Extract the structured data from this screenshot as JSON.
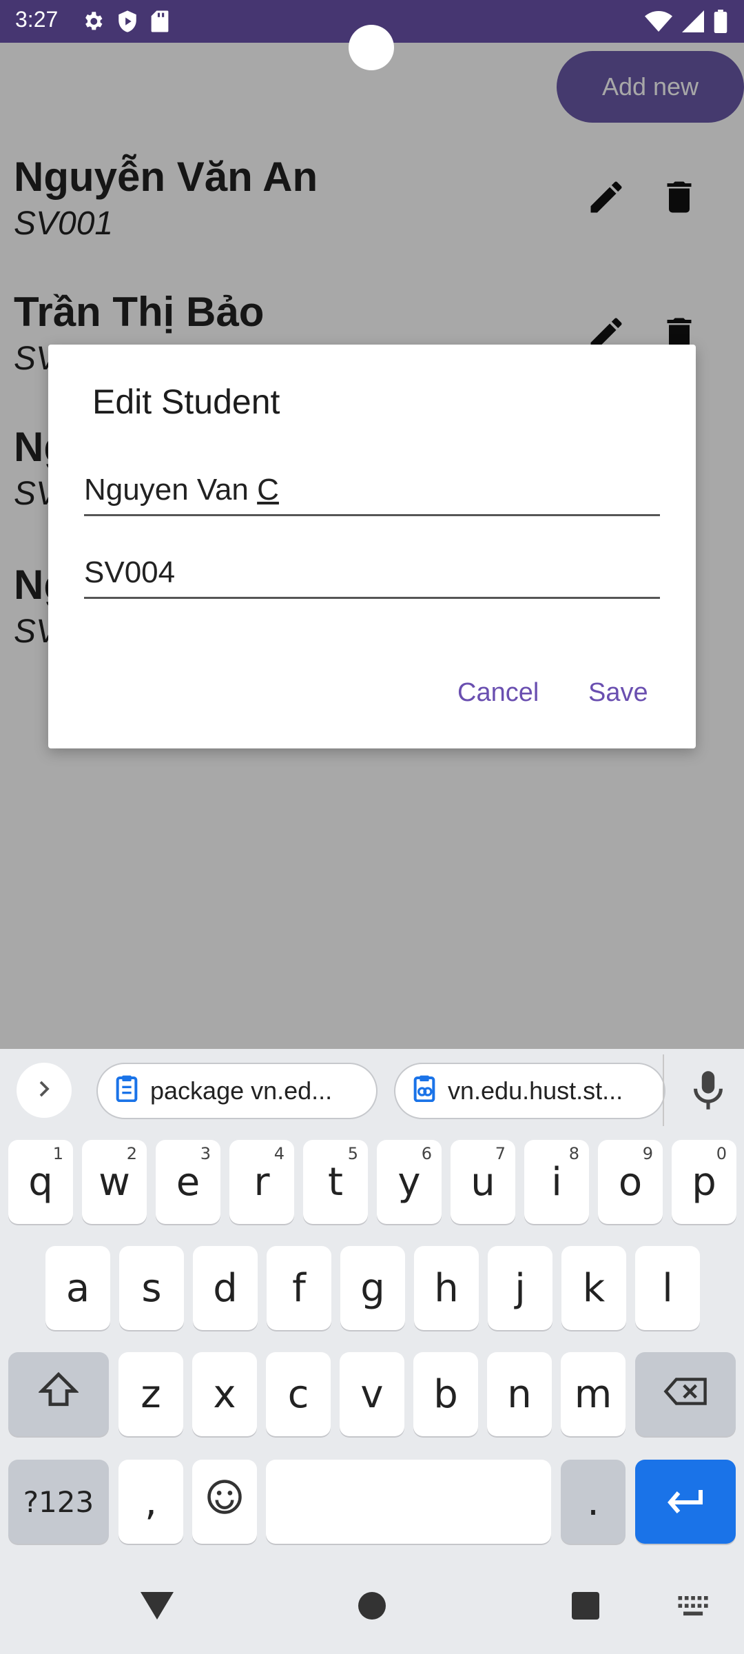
{
  "status_bar": {
    "time": "3:27"
  },
  "app": {
    "add_new_label": "Add new",
    "students": [
      {
        "name": "Nguyễn Văn An",
        "id": "SV001"
      },
      {
        "name": "Trần Thị Bảo",
        "id": "SV"
      },
      {
        "name": "Ng",
        "id": "SV"
      },
      {
        "name": "Ng",
        "id": "SV"
      }
    ]
  },
  "dialog": {
    "title": "Edit Student",
    "name_value_prefix": "Nguyen Van ",
    "name_value_cursor_word": "C",
    "id_value": "SV004",
    "cancel_label": "Cancel",
    "save_label": "Save"
  },
  "keyboard": {
    "clipboard_chips": [
      "package vn.ed...",
      "vn.edu.hust.st..."
    ],
    "row1": [
      {
        "k": "q",
        "h": "1"
      },
      {
        "k": "w",
        "h": "2"
      },
      {
        "k": "e",
        "h": "3"
      },
      {
        "k": "r",
        "h": "4"
      },
      {
        "k": "t",
        "h": "5"
      },
      {
        "k": "y",
        "h": "6"
      },
      {
        "k": "u",
        "h": "7"
      },
      {
        "k": "i",
        "h": "8"
      },
      {
        "k": "o",
        "h": "9"
      },
      {
        "k": "p",
        "h": "0"
      }
    ],
    "row2": [
      "a",
      "s",
      "d",
      "f",
      "g",
      "h",
      "j",
      "k",
      "l"
    ],
    "row3": [
      "z",
      "x",
      "c",
      "v",
      "b",
      "n",
      "m"
    ],
    "symbols_label": "?123",
    "comma_label": ",",
    "period_label": "."
  },
  "colors": {
    "status_bar": "#463671",
    "accent": "#6a58a8",
    "enter": "#1a73e8"
  }
}
